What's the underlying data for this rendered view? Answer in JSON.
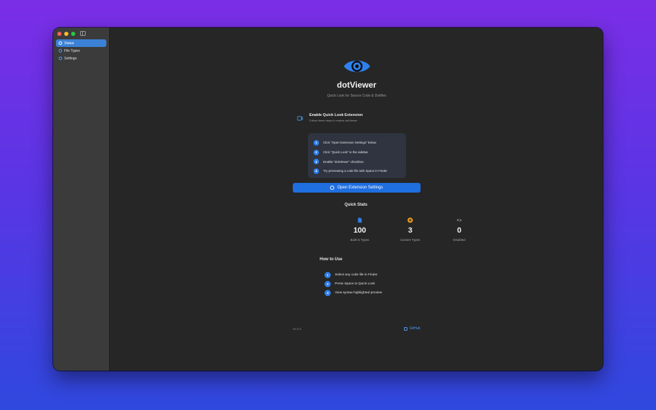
{
  "window": {
    "traffic_lights": [
      "close",
      "minimize",
      "zoom"
    ]
  },
  "sidebar": {
    "items": [
      {
        "label": "Status",
        "icon": "status-icon",
        "active": true
      },
      {
        "label": "File Types",
        "icon": "file-icon",
        "active": false
      },
      {
        "label": "Settings",
        "icon": "gear-icon",
        "active": false
      }
    ]
  },
  "header": {
    "app_name": "dotViewer",
    "subtitle": "Quick Look for Source Code & Dotfiles",
    "logo_icon": "eye-icon"
  },
  "enable": {
    "title": "Enable Quick Look Extension",
    "subtitle": "Follow these steps to enable dotViewer",
    "steps": [
      {
        "num": "1",
        "text": "Click \"Open Extension Settings\" below"
      },
      {
        "num": "2",
        "text": "Click \"Quick Look\" in the sidebar"
      },
      {
        "num": "3",
        "text": "Enable \"dotViewer\" checkbox"
      },
      {
        "num": "4",
        "text": "Try previewing a code file with Space in Finder"
      }
    ],
    "button_label": "Open Extension Settings"
  },
  "stats": {
    "title": "Quick Stats",
    "items": [
      {
        "value": "100",
        "label": "Built-in Types",
        "icon": "document-icon",
        "color": "#2f80ed"
      },
      {
        "value": "3",
        "label": "Custom Types",
        "icon": "plus-circle-icon",
        "color": "#f39c12"
      },
      {
        "value": "0",
        "label": "Disabled",
        "icon": "eye-slash-icon",
        "color": "#8e8e93"
      }
    ]
  },
  "how_to": {
    "title": "How to Use",
    "steps": [
      {
        "num": "1",
        "text": "Select any code file in Finder"
      },
      {
        "num": "2",
        "text": "Press Space to Quick Look"
      },
      {
        "num": "3",
        "text": "View syntax-highlighted preview"
      }
    ]
  },
  "footer": {
    "version": "v1.0.1",
    "github_label": "GitHub"
  },
  "colors": {
    "accent": "#2f80ed",
    "background": "#262626",
    "sidebar": "#3b3b3c"
  }
}
